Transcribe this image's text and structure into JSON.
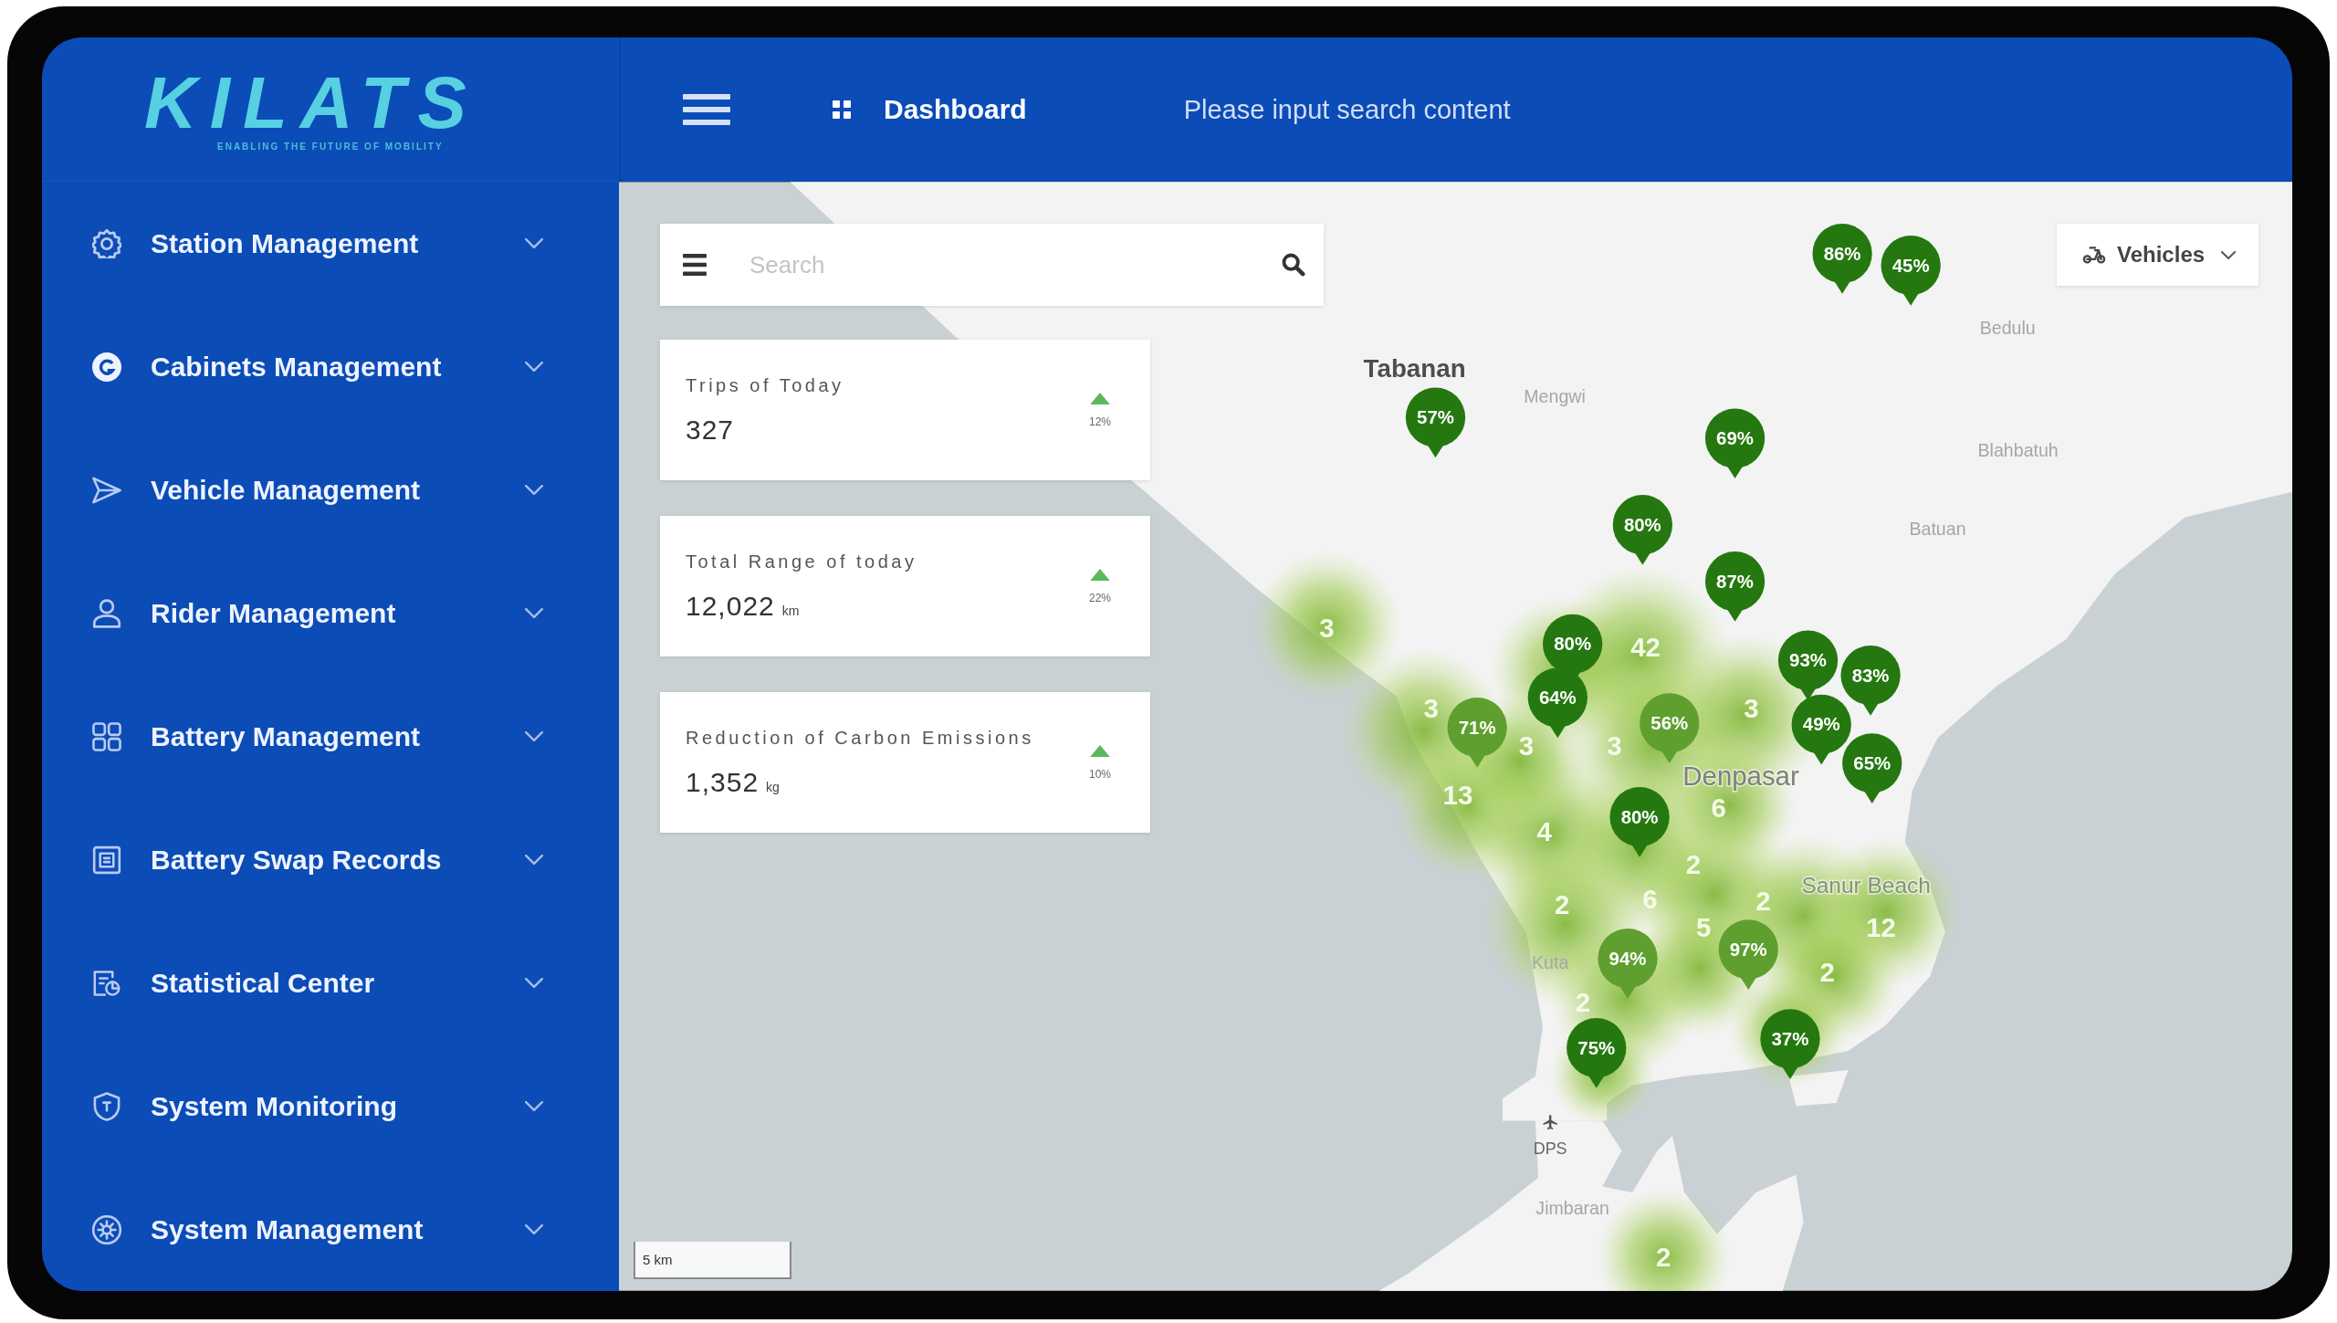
{
  "logo": {
    "name": "KILATS",
    "tagline": "ENABLING THE FUTURE OF MOBILITY"
  },
  "sidebar": {
    "items": [
      {
        "label": "Station Management",
        "expanded": false
      },
      {
        "label": "Cabinets Management",
        "expanded": false
      },
      {
        "label": "Vehicle Management",
        "expanded": false
      },
      {
        "label": "Rider Management",
        "expanded": false
      },
      {
        "label": "Battery Management",
        "expanded": false
      },
      {
        "label": "Battery Swap Records",
        "expanded": false
      },
      {
        "label": "Statistical Center",
        "expanded": false
      },
      {
        "label": "System Monitoring",
        "expanded": false
      },
      {
        "label": "System Management",
        "expanded": false
      }
    ]
  },
  "topbar": {
    "breadcrumb": "Dashboard",
    "search": {
      "placeholder": "Please input search content"
    }
  },
  "map": {
    "search": {
      "placeholder": "Search"
    },
    "stats": [
      {
        "title": "Trips of Today",
        "value": "327",
        "kind": "up",
        "change": "12%"
      },
      {
        "title": "Total Range of today",
        "value": "12,022",
        "unit": "km",
        "kind": "up",
        "change": "22%"
      },
      {
        "title": "Reduction of Carbon Emissions",
        "value": "1,352",
        "unit": "kg",
        "kind": "up",
        "change": "10%"
      }
    ],
    "layer_select": {
      "label": "Vehicles"
    },
    "places": [
      {
        "name": "Tabanan",
        "kind": "town"
      },
      {
        "name": "Mengwi",
        "kind": "village"
      },
      {
        "name": "Bedulu",
        "kind": "village"
      },
      {
        "name": "Blahbatuh",
        "kind": "village"
      },
      {
        "name": "Batuan",
        "kind": "village"
      },
      {
        "name": "Denpasar",
        "kind": "city"
      },
      {
        "name": "Sanur Beach",
        "kind": "area"
      },
      {
        "name": "Kuta",
        "kind": "village"
      },
      {
        "name": "DPS",
        "kind": "airport"
      },
      {
        "name": "Jimbaran",
        "kind": "village"
      }
    ],
    "clusters": [
      "3",
      "42",
      "3",
      "3",
      "3",
      "3",
      "13",
      "6",
      "4",
      "2",
      "2",
      "6",
      "5",
      "2",
      "12",
      "2",
      "2",
      "2"
    ],
    "pins": [
      {
        "label": "86%",
        "faded": false
      },
      {
        "label": "45%",
        "faded": false
      },
      {
        "label": "57%",
        "faded": false
      },
      {
        "label": "69%",
        "faded": false
      },
      {
        "label": "80%",
        "faded": false
      },
      {
        "label": "87%",
        "faded": false
      },
      {
        "label": "80%",
        "faded": false
      },
      {
        "label": "64%",
        "faded": false
      },
      {
        "label": "71%",
        "faded": true
      },
      {
        "label": "56%",
        "faded": true
      },
      {
        "label": "93%",
        "faded": false
      },
      {
        "label": "83%",
        "faded": false
      },
      {
        "label": "49%",
        "faded": false
      },
      {
        "label": "65%",
        "faded": false
      },
      {
        "label": "80%",
        "faded": false
      },
      {
        "label": "94%",
        "faded": true
      },
      {
        "label": "97%",
        "faded": true
      },
      {
        "label": "75%",
        "faded": false
      },
      {
        "label": "37%",
        "faded": false
      }
    ],
    "scale": "5 km"
  }
}
